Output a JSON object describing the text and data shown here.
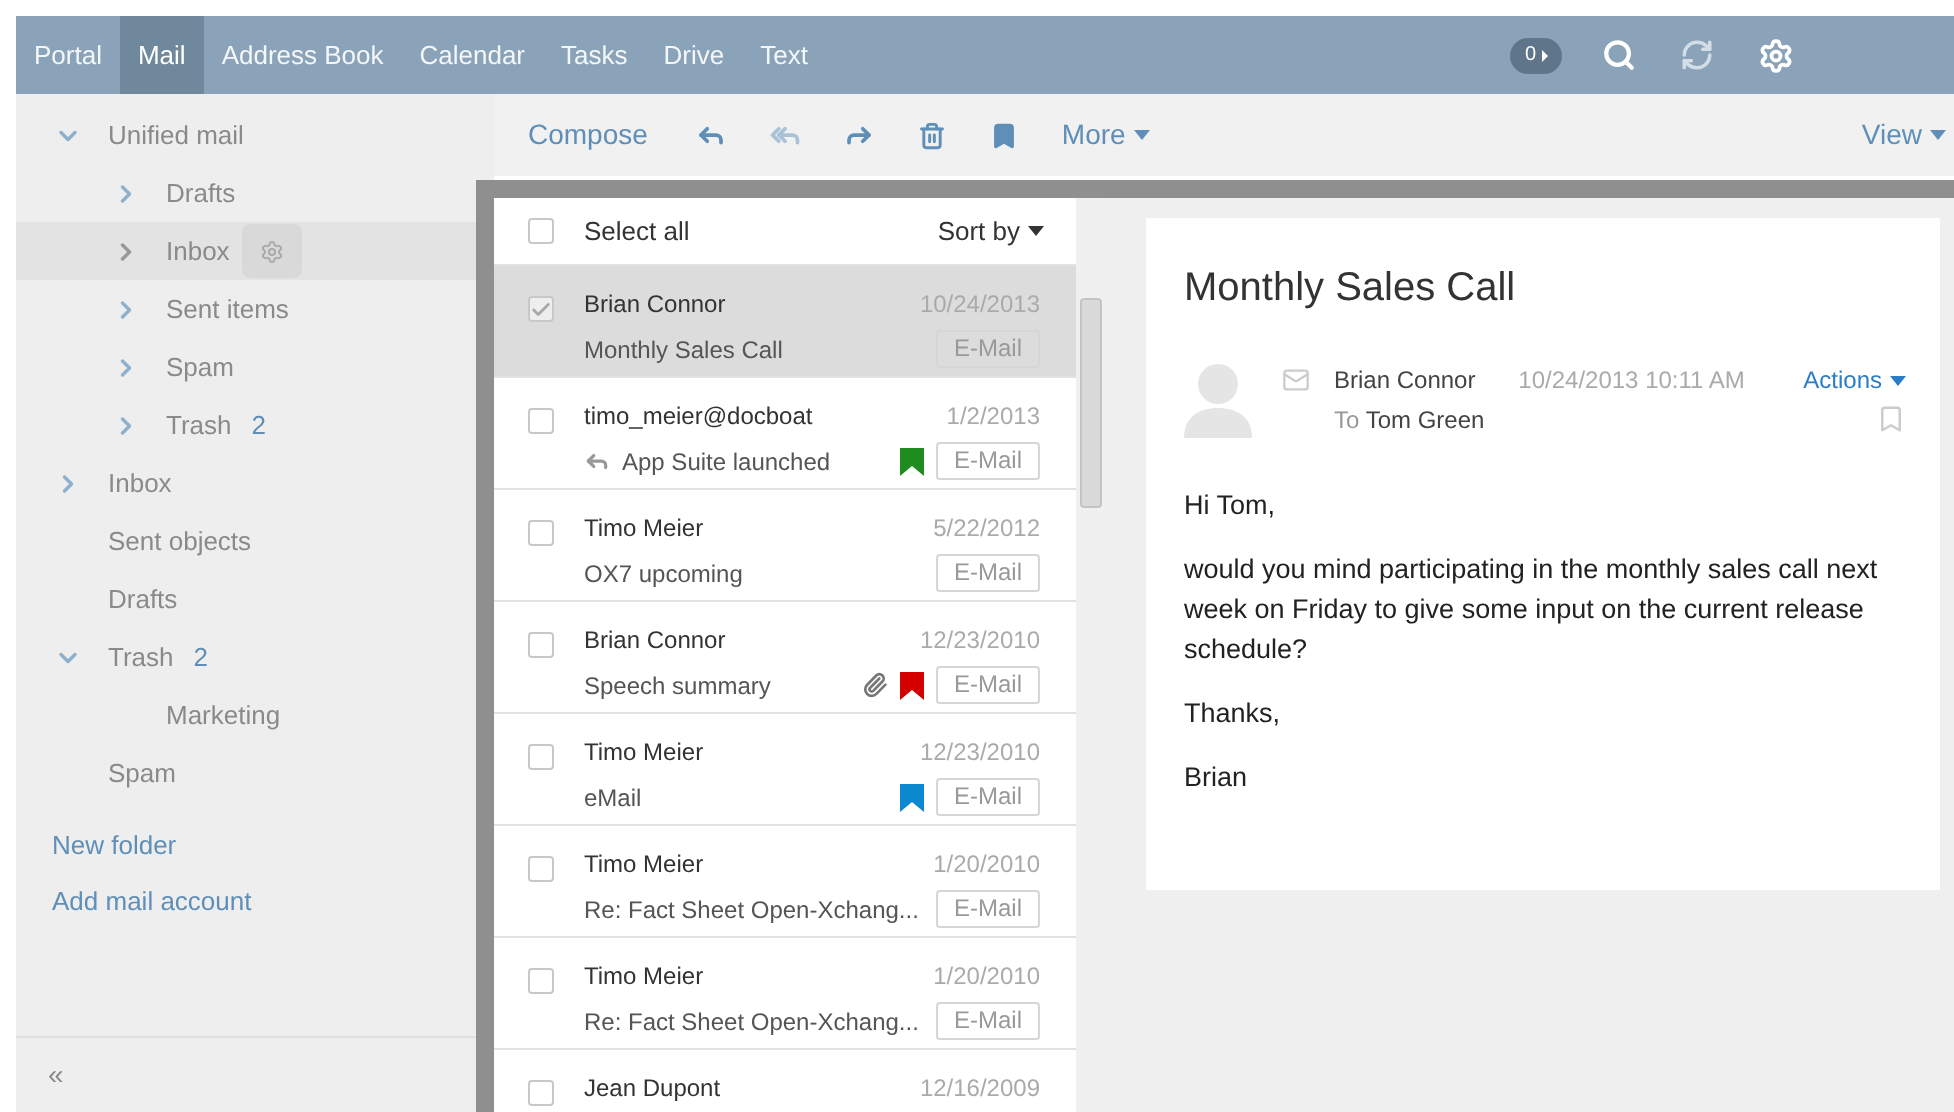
{
  "top_nav": {
    "items": [
      {
        "label": "Portal",
        "selected": false
      },
      {
        "label": "Mail",
        "selected": true
      },
      {
        "label": "Address Book",
        "selected": false
      },
      {
        "label": "Calendar",
        "selected": false
      },
      {
        "label": "Tasks",
        "selected": false
      },
      {
        "label": "Drive",
        "selected": false
      },
      {
        "label": "Text",
        "selected": false
      }
    ],
    "badge": "0"
  },
  "sidebar": {
    "folders": [
      {
        "label": "Unified mail",
        "expanded": true,
        "selected": false,
        "children": [
          {
            "label": "Drafts",
            "expanded": false,
            "selected": false
          },
          {
            "label": "Inbox",
            "expanded": false,
            "selected": true
          },
          {
            "label": "Sent items",
            "expanded": false,
            "selected": false
          },
          {
            "label": "Spam",
            "expanded": false,
            "selected": false
          },
          {
            "label": "Trash",
            "count": "2",
            "expanded": false,
            "selected": false
          }
        ]
      },
      {
        "label": "Inbox",
        "expanded": false,
        "selected": false
      },
      {
        "label": "Sent objects",
        "selected": false
      },
      {
        "label": "Drafts",
        "selected": false
      },
      {
        "label": "Trash",
        "count": "2",
        "expanded": true,
        "selected": false,
        "children": [
          {
            "label": "Marketing",
            "selected": false
          }
        ]
      },
      {
        "label": "Spam",
        "selected": false
      }
    ],
    "links": [
      "New folder",
      "Add mail account"
    ],
    "collapse": "«"
  },
  "toolbar": {
    "compose": "Compose",
    "more": "More",
    "view": "View"
  },
  "mail_list": {
    "select_all": {
      "label": "Select all",
      "checked": false
    },
    "sort_by": "Sort by",
    "rows": [
      {
        "sender": "Brian Connor",
        "date": "10/24/2013",
        "subject": "Monthly Sales Call",
        "tag": "E-Mail",
        "selected": true,
        "checked": true,
        "replied": false,
        "attachment": false
      },
      {
        "sender": "timo_meier@docboat",
        "date": "1/2/2013",
        "subject": "App Suite launched",
        "tag": "E-Mail",
        "selected": false,
        "checked": false,
        "replied": true,
        "attachment": false,
        "color": "#1e8c1e"
      },
      {
        "sender": "Timo Meier",
        "date": "5/22/2012",
        "subject": "OX7 upcoming",
        "tag": "E-Mail",
        "selected": false,
        "checked": false,
        "replied": false,
        "attachment": false
      },
      {
        "sender": "Brian Connor",
        "date": "12/23/2010",
        "subject": "Speech summary",
        "tag": "E-Mail",
        "selected": false,
        "checked": false,
        "replied": false,
        "attachment": true,
        "color": "#d40000"
      },
      {
        "sender": "Timo Meier",
        "date": "12/23/2010",
        "subject": "eMail",
        "tag": "E-Mail",
        "selected": false,
        "checked": false,
        "replied": false,
        "attachment": false,
        "color": "#0b88d0"
      },
      {
        "sender": "Timo Meier",
        "date": "1/20/2010",
        "subject": "Re: Fact Sheet Open-Xchang...",
        "tag": "E-Mail",
        "selected": false,
        "checked": false,
        "replied": false,
        "attachment": false
      },
      {
        "sender": "Timo Meier",
        "date": "1/20/2010",
        "subject": "Re: Fact Sheet Open-Xchang...",
        "tag": "E-Mail",
        "selected": false,
        "checked": false,
        "replied": false,
        "attachment": false
      },
      {
        "sender": "Jean Dupont",
        "date": "12/16/2009",
        "selected": false,
        "checked": false
      }
    ]
  },
  "detail": {
    "subject": "Monthly Sales Call",
    "from": "Brian Connor",
    "datetime": "10/24/2013 10:11 AM",
    "actions": "Actions",
    "to_label": "To",
    "to": "Tom Green",
    "body": [
      "Hi Tom,",
      "would you mind participating in the monthly sales call next week on Friday to give some input on the current release schedule?",
      "Thanks,",
      "Brian"
    ]
  }
}
